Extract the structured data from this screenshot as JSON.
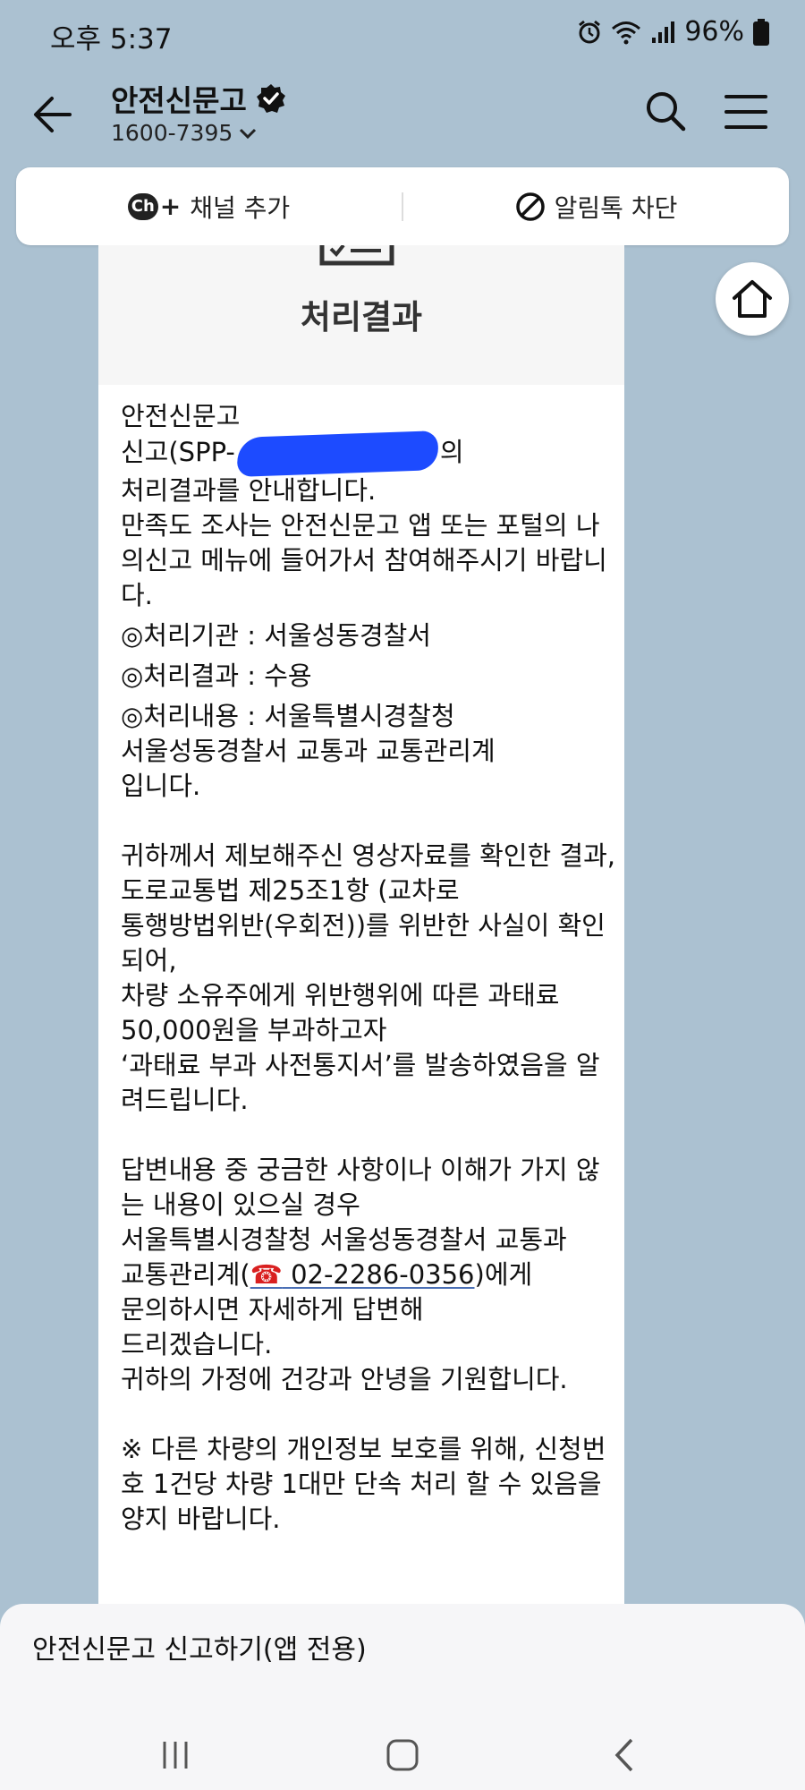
{
  "status_bar": {
    "time": "오후 5:37",
    "battery": "96%"
  },
  "header": {
    "channel_name": "안전신문고",
    "phone": "1600-7395"
  },
  "actions": {
    "add_channel": "채널 추가",
    "block_alerts": "알림톡 차단",
    "ch_badge": "Ch"
  },
  "card": {
    "title": "처리결과",
    "lines": {
      "l1": "안전신문고",
      "l2_prefix": "신고(SPP-",
      "l2_suffix": "의",
      "l3": "처리결과를 안내합니다.",
      "l4": "만족도 조사는 안전신문고 앱 또는 포털의 나의신고 메뉴에 들어가서 참여해주시기 바랍니다.",
      "l5": "◎처리기관 : 서울성동경찰서",
      "l6": "◎처리결과 : 수용",
      "l7": "◎처리내용 : 서울특별시경찰청",
      "l8": "서울성동경찰서 교통과 교통관리계",
      "l9": "입니다.",
      "l10": "귀하께서 제보해주신 영상자료를 확인한 결과,",
      "l11": "도로교통법 제25조1항 (교차로",
      "l12": "통행방법위반(우회전))를 위반한 사실이 확인되어,",
      "l13": "차량 소유주에게 위반행위에 따른 과태료 50,000원을 부과하고자",
      "l14": "‘과태료 부과 사전통지서’를 발송하였음을 알려드립니다.",
      "l15": "답변내용 중 궁금한 사항이나 이해가 가지 않는 내용이 있으실 경우",
      "l16": "서울특별시경찰청 서울성동경찰서 교통과",
      "l17_prefix": "교통관리계(",
      "l17_phone_icon": "☎",
      "l17_phone": "02-2286-0356",
      "l17_suffix": ")에게",
      "l18": "문의하시면 자세하게 답변해",
      "l19": "드리겠습니다.",
      "l20": "귀하의 가정에 건강과 안녕을 기원합니다.",
      "l21": "※ 다른 차량의 개인정보 보호를 위해, 신청번호 1건당 차량 1대만 단속 처리 할 수 있음을 양지 바랍니다."
    }
  },
  "bottom_sheet": {
    "label": "안전신문고 신고하기(앱 전용)"
  },
  "icons": {
    "back": "arrow-left-icon",
    "verified": "verified-badge-icon",
    "search": "search-icon",
    "menu": "hamburger-menu-icon",
    "block": "block-icon",
    "home": "home-icon"
  },
  "colors": {
    "background": "#abc1d1",
    "redaction": "#1d4bff"
  }
}
